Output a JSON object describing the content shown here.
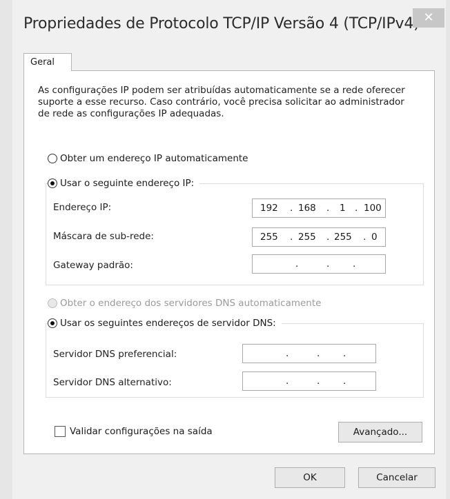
{
  "window": {
    "title": "Propriedades de Protocolo TCP/IP Versão 4 (TCP/IPv4)",
    "close_label": "✕"
  },
  "tabs": [
    {
      "label": "Geral"
    }
  ],
  "description": "As configurações IP podem ser atribuídas automaticamente se a rede oferecer suporte a esse recurso. Caso contrário, você precisa solicitar ao administrador de rede as configurações IP adequadas.",
  "ip_section": {
    "auto_option": "Obter um endereço IP automaticamente",
    "manual_option": "Usar o seguinte endereço IP:",
    "selected": "manual",
    "fields": [
      {
        "label": "Endereço IP:",
        "octets": [
          "192",
          "168",
          "1",
          "100"
        ]
      },
      {
        "label": "Máscara de sub-rede:",
        "octets": [
          "255",
          "255",
          "255",
          "0"
        ]
      },
      {
        "label": "Gateway padrão:",
        "octets": [
          "",
          "",
          "",
          ""
        ]
      }
    ]
  },
  "dns_section": {
    "auto_option": "Obter o endereço dos servidores DNS automaticamente",
    "manual_option": "Usar os seguintes endereços de servidor DNS:",
    "selected": "manual",
    "fields": [
      {
        "label": "Servidor DNS preferencial:",
        "octets": [
          "",
          "",
          "",
          ""
        ]
      },
      {
        "label": "Servidor DNS alternativo:",
        "octets": [
          "",
          "",
          "",
          ""
        ]
      }
    ]
  },
  "validate_checkbox": {
    "label": "Validar configurações na saída",
    "checked": false
  },
  "buttons": {
    "advanced": "Avançado...",
    "ok": "OK",
    "cancel": "Cancelar"
  }
}
